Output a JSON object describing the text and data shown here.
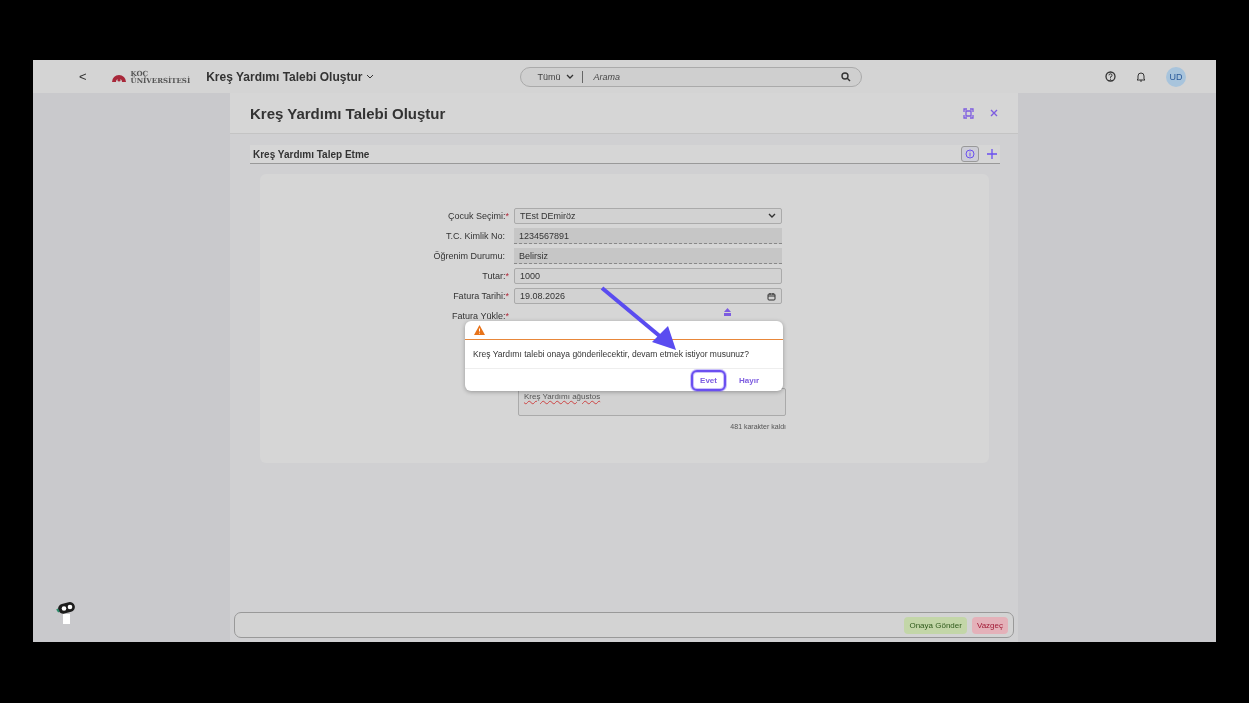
{
  "topbar": {
    "back": "<",
    "logo_top": "KOÇ",
    "logo_bottom": "ÜNİVERSİTESİ",
    "app_title": "Kreş Yardımı Talebi Oluştur",
    "search_scope": "Tümü",
    "search_placeholder": "Arama",
    "avatar": "UD"
  },
  "page": {
    "title": "Kreş Yardımı Talebi Oluştur",
    "section": "Kreş Yardımı Talep Etme"
  },
  "form": {
    "fields": [
      {
        "label": "Çocuk Seçimi:",
        "required": true,
        "kind": "select",
        "value": "TEst DEmiröz"
      },
      {
        "label": "T.C. Kimlik No:",
        "required": false,
        "kind": "readonly",
        "value": "1234567891"
      },
      {
        "label": "Öğrenim Durumu:",
        "required": false,
        "kind": "readonly",
        "value": "Belirsiz"
      },
      {
        "label": "Tutar:",
        "required": true,
        "kind": "input",
        "value": "1000"
      },
      {
        "label": "Fatura Tarihi:",
        "required": true,
        "kind": "date",
        "value": "19.08.2026"
      },
      {
        "label": "Fatura Yükle:",
        "required": true,
        "kind": "upload"
      }
    ],
    "required_mark": "*",
    "note": {
      "value": "Kreş Yardımı ağustos",
      "counter": "481 karakter kaldı"
    }
  },
  "dialog": {
    "message": "Kreş Yardımı talebi onaya gönderilecektir, devam etmek istiyor musunuz?",
    "buttons": [
      {
        "label": "Evet",
        "selected": true
      },
      {
        "label": "Hayır",
        "selected": false
      }
    ]
  },
  "footer": {
    "buttons": [
      {
        "label": "Onaya Gönder",
        "kind": "accept"
      },
      {
        "label": "Vazgeç",
        "kind": "reject"
      }
    ]
  }
}
